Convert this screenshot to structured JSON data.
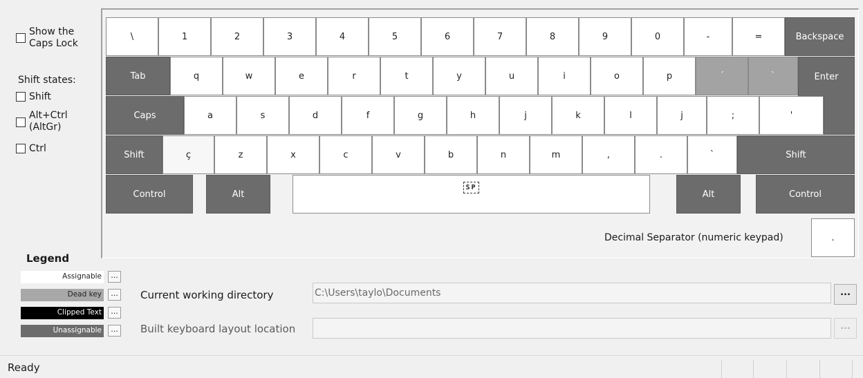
{
  "options": {
    "show_caps_lock_label": "Show the Caps Lock",
    "show_caps_lock_line1": "Show the",
    "show_caps_lock_line2": "Caps Lock",
    "shift_states_label": "Shift states:",
    "shift_label": "Shift",
    "altgr_line1": "Alt+Ctrl",
    "altgr_line2": "(AltGr)",
    "ctrl_label": "Ctrl"
  },
  "keyboard": {
    "row1": [
      "\\",
      "1",
      "2",
      "3",
      "4",
      "5",
      "6",
      "7",
      "8",
      "9",
      "0",
      "-",
      "=",
      "Backspace"
    ],
    "row2": [
      "Tab",
      "q",
      "w",
      "e",
      "r",
      "t",
      "y",
      "u",
      "i",
      "o",
      "p",
      "´",
      "`",
      "Enter"
    ],
    "row3": [
      "Caps",
      "a",
      "s",
      "d",
      "f",
      "g",
      "h",
      "j",
      "k",
      "l",
      "j",
      ";",
      "'"
    ],
    "row4": [
      "Shift",
      "ç",
      "z",
      "x",
      "c",
      "v",
      "b",
      "n",
      "m",
      ",",
      ".",
      "`",
      "Shift"
    ],
    "row5": [
      "Control",
      "Alt",
      "SP",
      "Alt",
      "Control"
    ],
    "decimal_separator_label": "Decimal Separator (numeric keypad)",
    "decimal_separator_value": "."
  },
  "legend": {
    "title": "Legend",
    "items": [
      {
        "label": "Assignable",
        "color": "#ffffff",
        "text_color": "#222222"
      },
      {
        "label": "Dead key",
        "color": "#a8a8a8",
        "text_color": "#222222"
      },
      {
        "label": "Clipped Text",
        "color": "#000000",
        "text_color": "#ffffff"
      },
      {
        "label": "Unassignable",
        "color": "#6c6c6c",
        "text_color": "#ffffff"
      }
    ],
    "button_label": "..."
  },
  "paths": {
    "cwd_label": "Current working directory",
    "cwd_value": "C:\\Users\\taylo\\Documents",
    "build_label": "Built keyboard layout location",
    "build_value": "",
    "browse_label": "..."
  },
  "status": {
    "text": "Ready"
  },
  "colors": {
    "assignable": "#ffffff",
    "dead_key": "#a3a3a3",
    "unassignable": "#6c6c6c",
    "clipped": "#000000"
  }
}
